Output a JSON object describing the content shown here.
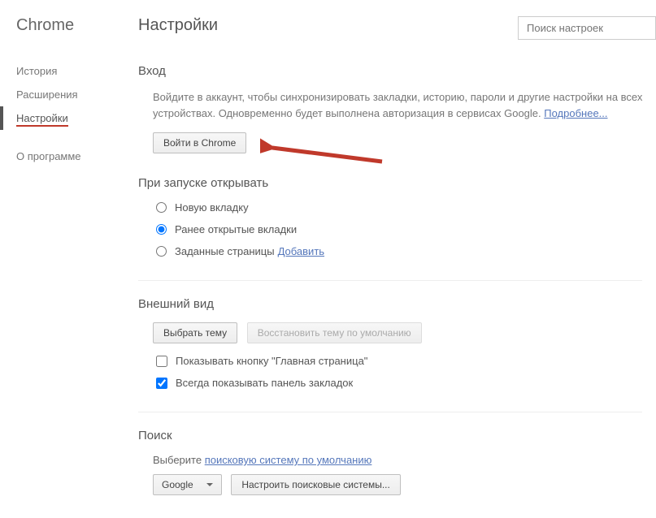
{
  "sidebar": {
    "title": "Chrome",
    "items": [
      {
        "label": "История"
      },
      {
        "label": "Расширения"
      },
      {
        "label": "Настройки"
      },
      {
        "label": "О программе"
      }
    ],
    "activeIndex": 2
  },
  "header": {
    "title": "Настройки",
    "searchPlaceholder": "Поиск настроек"
  },
  "login": {
    "title": "Вход",
    "desc": "Войдите в аккаунт, чтобы синхронизировать закладки, историю, пароли и другие настройки на всех устройствах. Одновременно будет выполнена авторизация в сервисах Google. ",
    "moreLink": "Подробнее...",
    "button": "Войти в Chrome"
  },
  "startup": {
    "title": "При запуске открывать",
    "options": [
      {
        "label": "Новую вкладку",
        "checked": false
      },
      {
        "label": "Ранее открытые вкладки",
        "checked": true
      },
      {
        "label": "Заданные страницы",
        "checked": false,
        "link": "Добавить"
      }
    ]
  },
  "appearance": {
    "title": "Внешний вид",
    "themeBtn": "Выбрать тему",
    "resetThemeBtn": "Восстановить тему по умолчанию",
    "checks": [
      {
        "label": "Показывать кнопку \"Главная страница\"",
        "checked": false
      },
      {
        "label": "Всегда показывать панель закладок",
        "checked": true
      }
    ]
  },
  "search": {
    "title": "Поиск",
    "descPrefix": "Выберите ",
    "descLink": "поисковую систему по умолчанию",
    "engine": "Google",
    "manageBtn": "Настроить поисковые системы..."
  }
}
